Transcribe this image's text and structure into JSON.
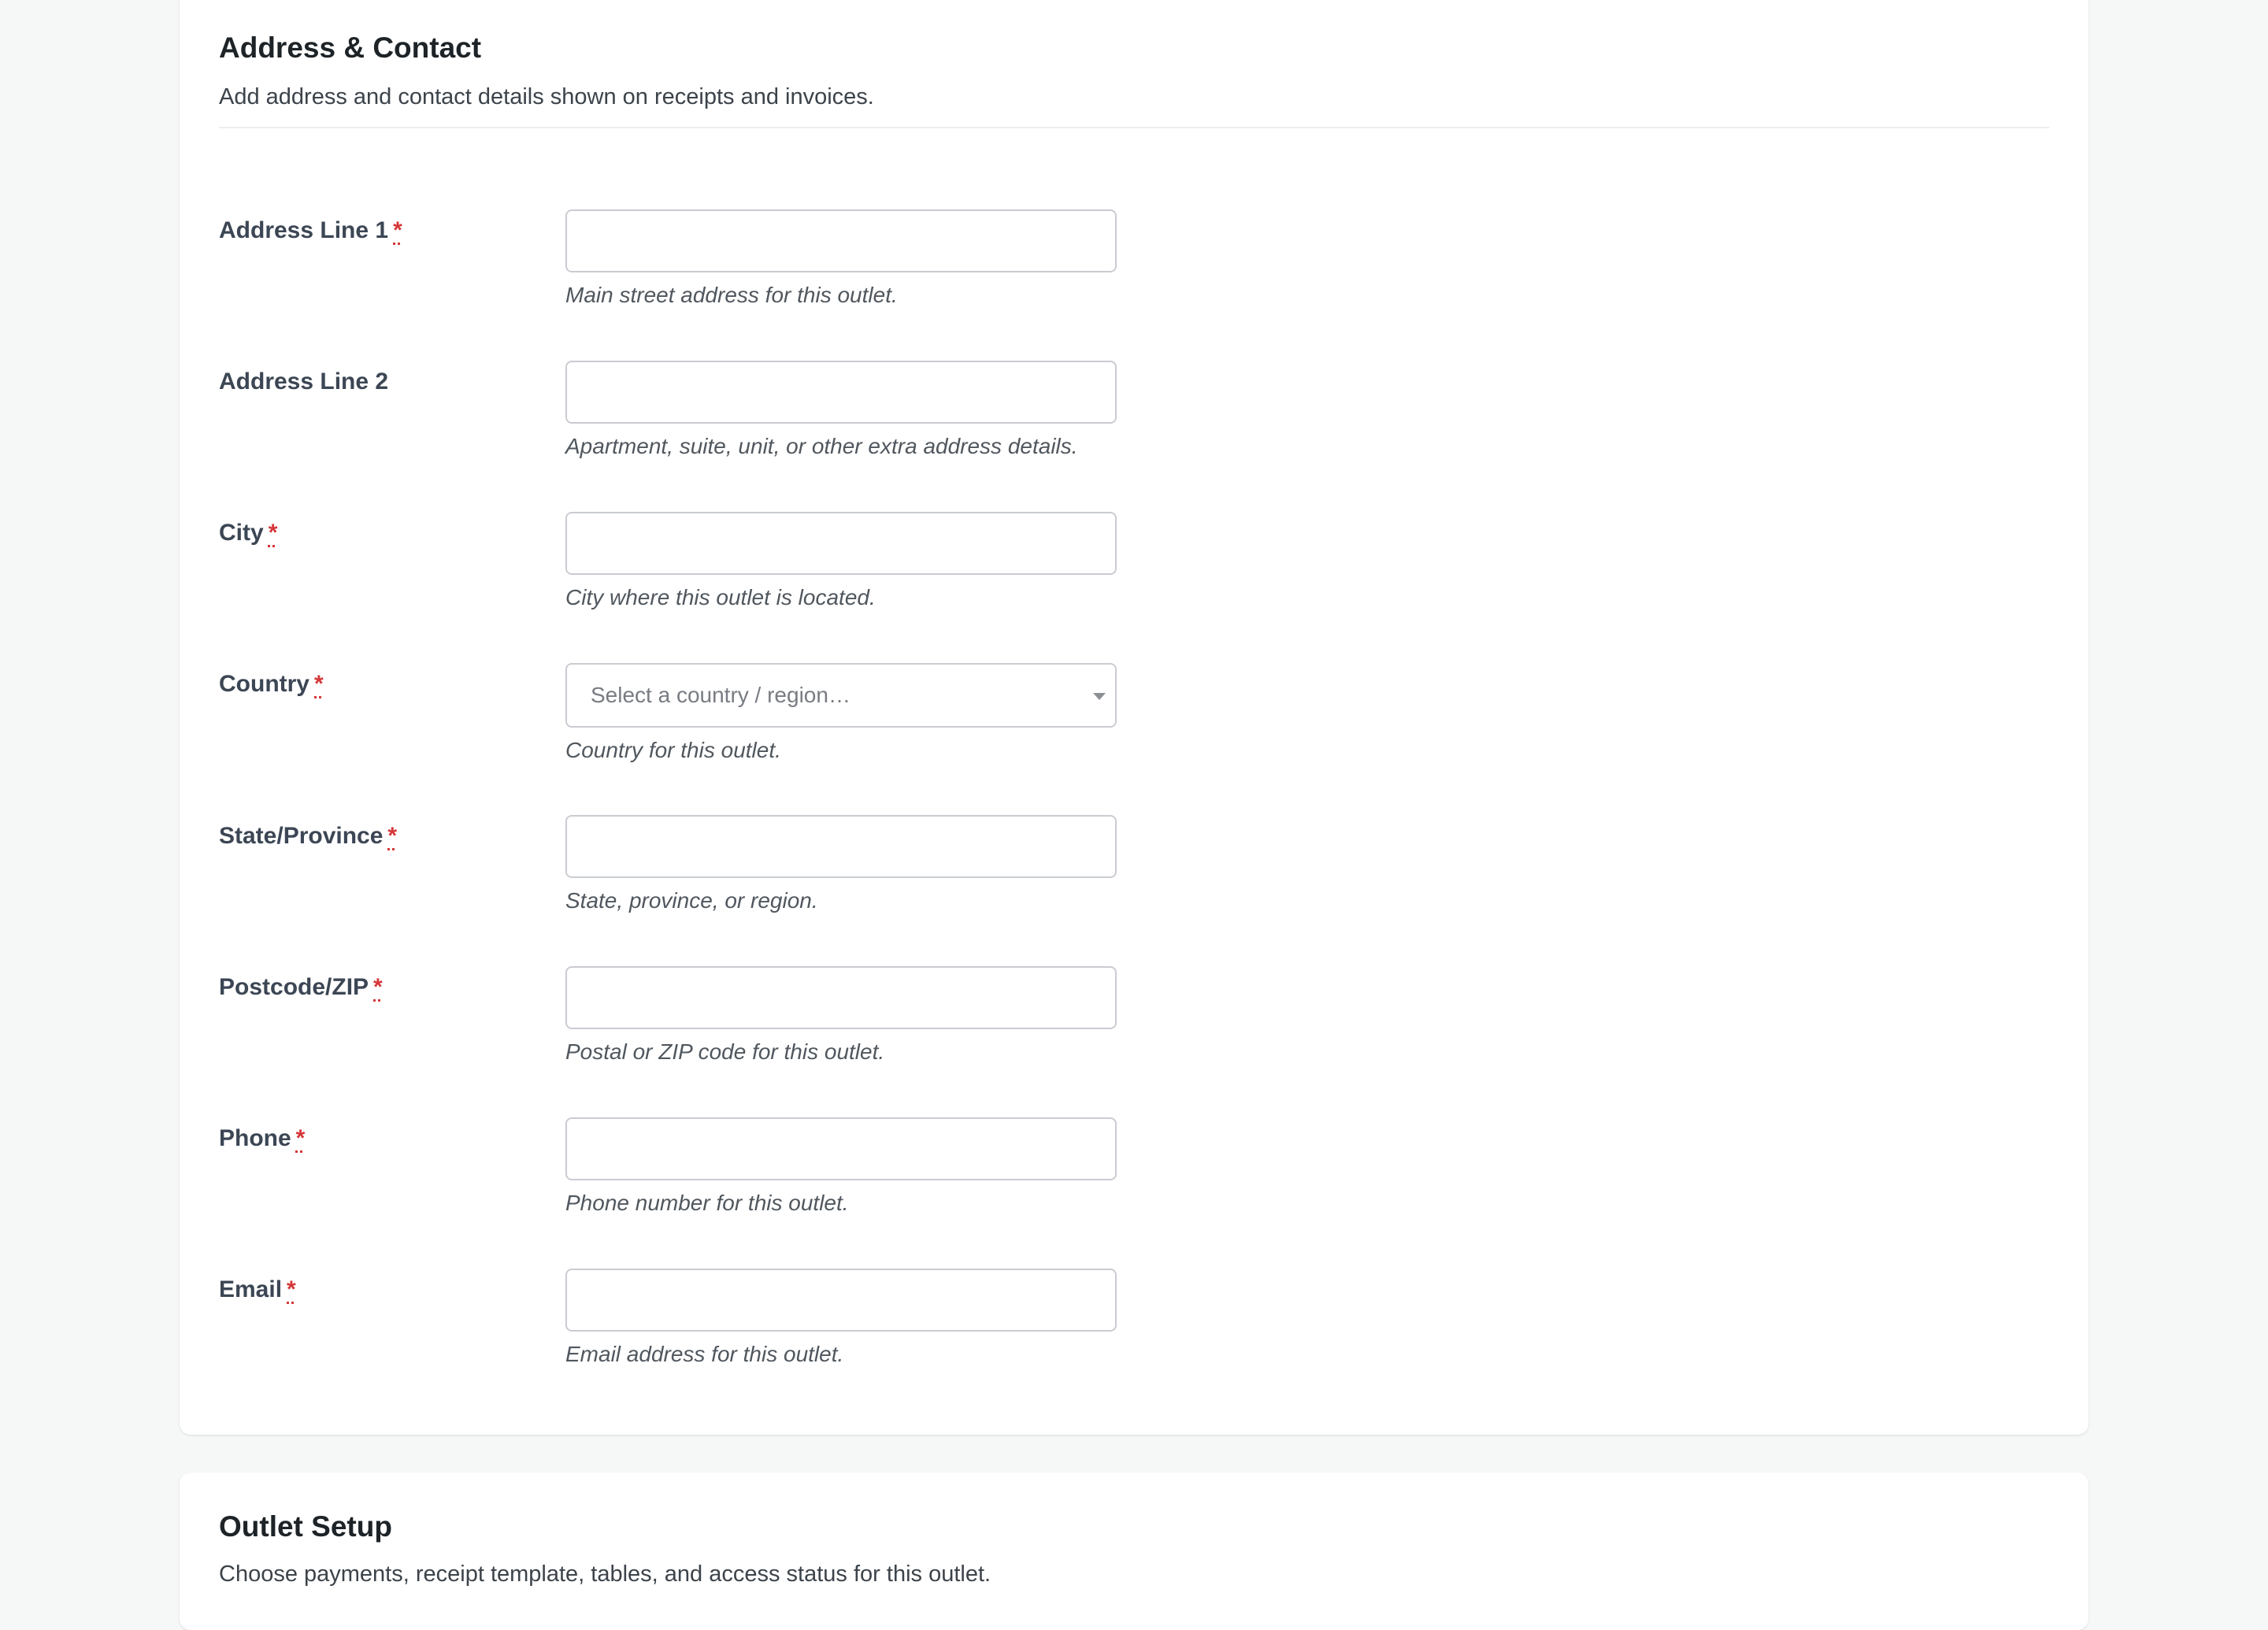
{
  "address_section": {
    "title": "Address & Contact",
    "description": "Add address and contact details shown on receipts and invoices.",
    "required_marker": "*",
    "fields": [
      {
        "label": "Address Line 1",
        "required": true,
        "type": "text",
        "value": "",
        "help": "Main street address for this outlet."
      },
      {
        "label": "Address Line 2",
        "required": false,
        "type": "text",
        "value": "",
        "help": "Apartment, suite, unit, or other extra address details."
      },
      {
        "label": "City",
        "required": true,
        "type": "text",
        "value": "",
        "help": "City where this outlet is located."
      },
      {
        "label": "Country",
        "required": true,
        "type": "select",
        "placeholder": "Select a country / region…",
        "help": "Country for this outlet."
      },
      {
        "label": "State/Province",
        "required": true,
        "type": "text",
        "value": "",
        "help": "State, province, or region."
      },
      {
        "label": "Postcode/ZIP",
        "required": true,
        "type": "text",
        "value": "",
        "help": "Postal or ZIP code for this outlet."
      },
      {
        "label": "Phone",
        "required": true,
        "type": "text",
        "value": "",
        "help": "Phone number for this outlet."
      },
      {
        "label": "Email",
        "required": true,
        "type": "text",
        "value": "",
        "help": "Email address for this outlet."
      }
    ]
  },
  "outlet_section": {
    "title": "Outlet Setup",
    "description": "Choose payments, receipt template, tables, and access status for this outlet."
  },
  "colors": {
    "page_background": "#f6f7f7",
    "card_background": "#ffffff",
    "required_marker": "#d63638",
    "label_text": "#3c4654",
    "input_border": "#c9ccd1"
  },
  "icons": {
    "select_arrow": "caret-down-icon"
  }
}
